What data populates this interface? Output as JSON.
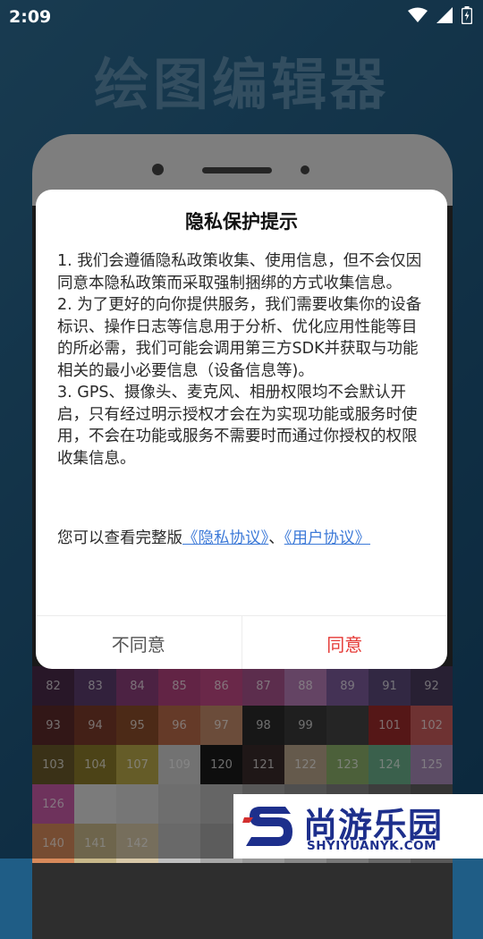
{
  "status_bar": {
    "time": "2:09",
    "icons": [
      "wifi-icon",
      "signal-icon",
      "battery-icon"
    ]
  },
  "app": {
    "title": "绘图编辑器"
  },
  "grid_numbers": [
    "82",
    "83",
    "84",
    "85",
    "86",
    "87",
    "88",
    "89",
    "91",
    "92",
    "93",
    "94",
    "95",
    "96",
    "97",
    "98",
    "99",
    "",
    "101",
    "102",
    "103",
    "104",
    "107",
    "109",
    "120",
    "121",
    "122",
    "123",
    "124",
    "125",
    "126",
    "",
    "",
    "",
    "",
    "",
    "",
    "",
    "",
    "",
    "140",
    "141",
    "142",
    "",
    "",
    "",
    "",
    "",
    "",
    ""
  ],
  "grid_colors": [
    "#4a2a4a",
    "#5b3c6e",
    "#8a3e7a",
    "#b2437e",
    "#c24a86",
    "#a8528d",
    "#b77cb7",
    "#7d5b9b",
    "#5b4a7a",
    "#4a3b5e",
    "#5b2a2a",
    "#7a3b2a",
    "#8a4e2a",
    "#b86a4a",
    "#c48b6a",
    "#2a2a2a",
    "#3a3a3a",
    "#444444",
    "#9b2a2a",
    "#c85b5b",
    "#6a5a2a",
    "#8a7a2a",
    "#b8a84a",
    "#d0d0d0",
    "#1a1a1a",
    "#3a2a2a",
    "#b8a48a",
    "#8ab06a",
    "#6ab08a",
    "#a88ab8",
    "#c85ba8",
    "#e0e0e0",
    "#d8d8d8",
    "#c8c8c8",
    "#b8b8b8",
    "#a0a0a0",
    "#909090",
    "#808080",
    "#707070",
    "#606060",
    "#d88a5b",
    "#c8b88a",
    "#d8c8a8",
    "#c0c0c0",
    "#a8a8a8",
    "#989898",
    "#888888",
    "#787878",
    "#686868",
    "#585858"
  ],
  "dialog": {
    "title": "隐私保护提示",
    "paragraphs": [
      "1. 我们会遵循隐私政策收集、使用信息，但不会仅因同意本隐私政策而采取强制捆绑的方式收集信息。",
      "2. 为了更好的向你提供服务，我们需要收集你的设备标识、操作日志等信息用于分析、优化应用性能等目的所必需，我们可能会调用第三方SDK并获取与功能相关的最小必要信息（设备信息等)。",
      "3. GPS、摄像头、麦克风、相册权限均不会默认开启，只有经过明示授权才会在为实现功能或服务时使用，不会在功能或服务不需要时而通过你授权的权限收集信息。"
    ],
    "consent_prefix": "您可以查看完整版",
    "privacy_link": "《隐私协议》",
    "separator": "、",
    "user_link": "《用户协议》",
    "decline_label": "不同意",
    "agree_label": "同意"
  },
  "watermark": {
    "cn": "尚游乐园",
    "en": "SHYIYUANYK.COM"
  },
  "colors": {
    "accent_red": "#e53935",
    "link_blue": "#3d7ad8",
    "bg_blue": "#1f5d86",
    "brand_navy": "#1d2f8c"
  }
}
